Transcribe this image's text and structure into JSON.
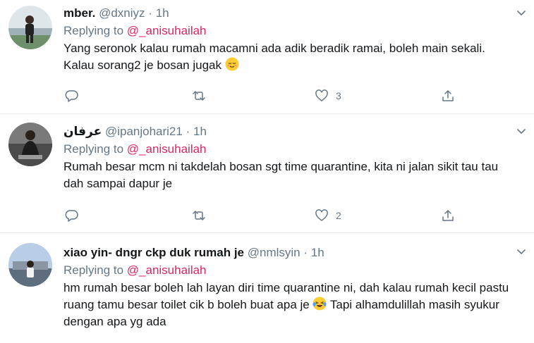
{
  "tweets": [
    {
      "name": "mber.",
      "handle": "@dxniyz",
      "dot": "·",
      "time": "1h",
      "replying_prefix": "Replying to ",
      "replying_to": "@_anisuhailah",
      "text": "Yang seronok kalau rumah macamni ada adik beradik ramai, boleh main sekali. Kalau sorang2 je bosan jugak",
      "emoji": "relieved-face",
      "like_count": "3"
    },
    {
      "name": "عرفان",
      "handle": "@ipanjohari21",
      "dot": "·",
      "time": "1h",
      "replying_prefix": "Replying to ",
      "replying_to": "@_anisuhailah",
      "text": "Rumah besar mcm ni takdelah bosan sgt time quarantine, kita ni jalan sikit tau tau dah sampai dapur je",
      "like_count": "2"
    },
    {
      "name": "xiao yin- dngr ckp duk rumah je",
      "handle": "@nmlsyin",
      "dot": "·",
      "time": "1h",
      "replying_prefix": "Replying to ",
      "replying_to": "@_anisuhailah",
      "text_a": "hm rumah besar boleh lah layan diri time quarantine ni, dah kalau rumah kecil pastu ruang tamu besar toilet cik b boleh buat apa je",
      "emoji": "face-with-tears-of-joy",
      "text_b": "Tapi alhamdulillah masih syukur dengan apa yg ada"
    }
  ],
  "colors": {
    "mention": "#e0245e",
    "secondary_text": "#657786",
    "divider": "#e6ecf0"
  },
  "icons": [
    "reply-icon",
    "retweet-icon",
    "like-icon",
    "share-icon",
    "chevron-down-icon"
  ]
}
